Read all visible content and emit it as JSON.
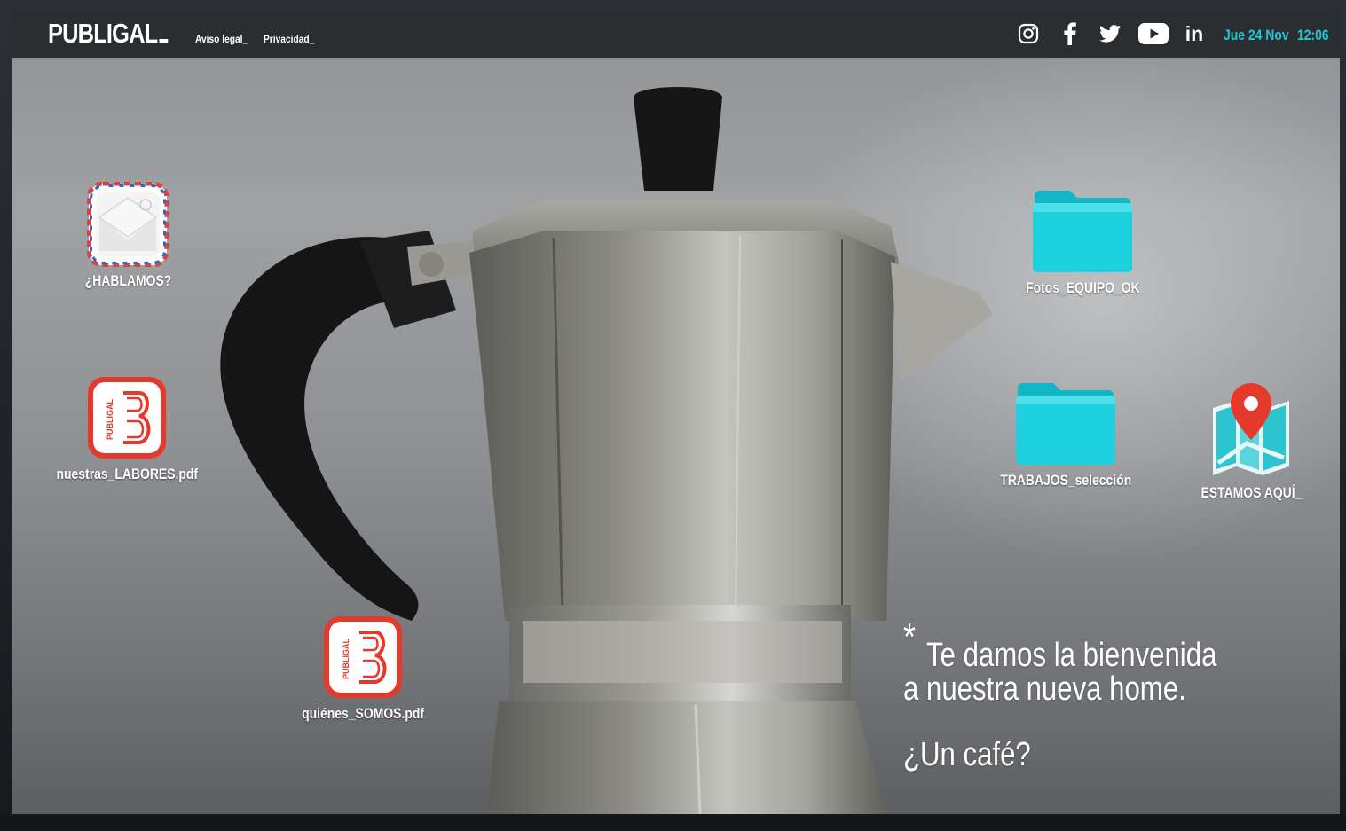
{
  "header": {
    "brand": "PUBLIGAL",
    "links": [
      "Aviso legal_",
      "Privacidad_"
    ],
    "social_icons": [
      "instagram-icon",
      "facebook-icon",
      "twitter-icon",
      "youtube-icon",
      "linkedin-icon"
    ],
    "social_labels": {
      "linkedin": "in"
    },
    "date": "Jue 24 Nov",
    "time": "12:06",
    "accent_color": "#1ec8d7"
  },
  "desktop": {
    "icons": [
      {
        "label": "¿HABLAMOS?",
        "icon": "mail-envelope-icon"
      },
      {
        "label": "nuestras_LABORES.pdf",
        "icon": "publigal-pdf-icon"
      },
      {
        "label": "quiénes_SOMOS.pdf",
        "icon": "publigal-pdf-icon"
      },
      {
        "label": "Fotos_EQUIPO_OK",
        "icon": "folder-icon"
      },
      {
        "label": "TRABAJOS_selección",
        "icon": "folder-icon"
      },
      {
        "label": "ESTAMOS AQUÍ_",
        "icon": "map-pin-icon"
      }
    ],
    "pdf_badge_text": "PUBLIGAL",
    "folder_color": "#19c6d4",
    "pdf_color": "#e5392b"
  },
  "welcome": {
    "asterisk": "*",
    "line1": "Te damos la bienvenida",
    "line2": "a nuestra nueva home.",
    "line3": "¿Un café?"
  }
}
